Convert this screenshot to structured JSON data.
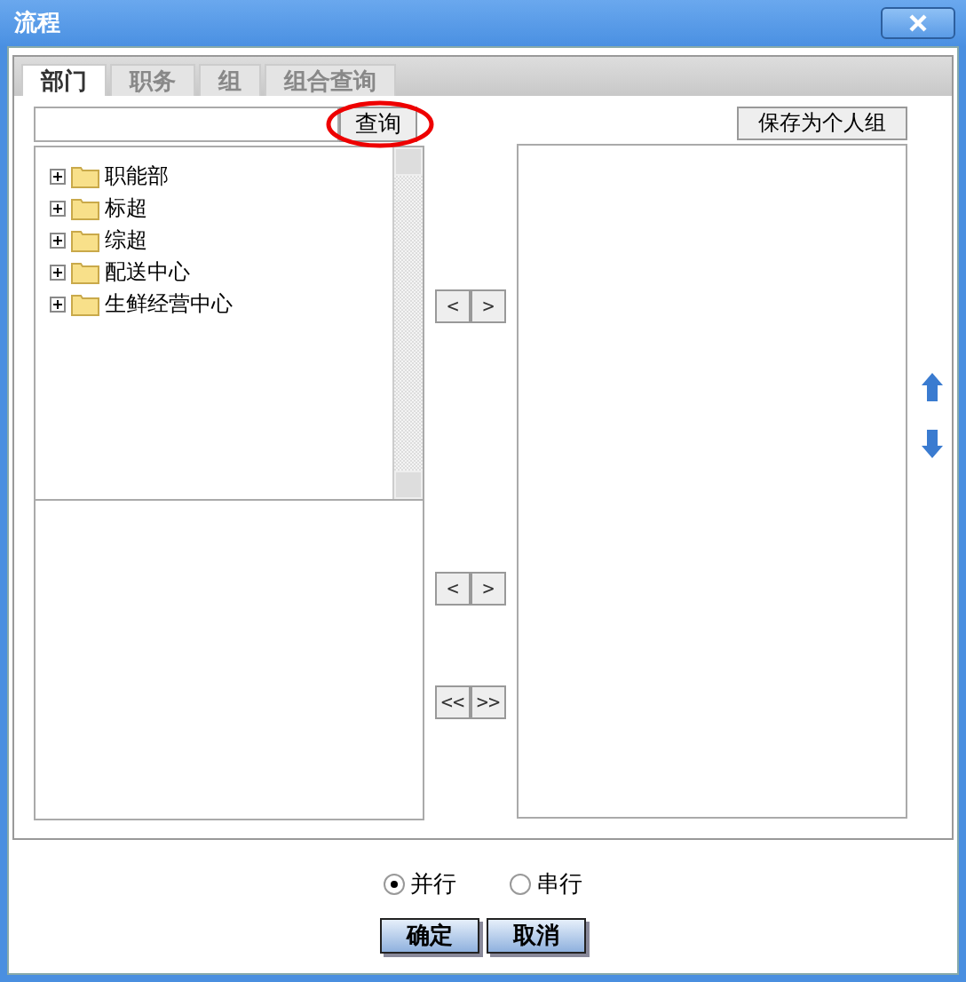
{
  "window": {
    "title": "流程"
  },
  "tabs": [
    {
      "label": "部门",
      "selected": true
    },
    {
      "label": "职务",
      "selected": false
    },
    {
      "label": "组",
      "selected": false
    },
    {
      "label": "组合查询",
      "selected": false
    }
  ],
  "search": {
    "button": "查询"
  },
  "save_button": "保存为个人组",
  "tree": [
    {
      "label": "职能部",
      "expanded": false
    },
    {
      "label": "标超",
      "expanded": false
    },
    {
      "label": "综超",
      "expanded": false
    },
    {
      "label": "配送中心",
      "expanded": false
    },
    {
      "label": "生鲜经营中心",
      "expanded": false
    }
  ],
  "transfer_buttons": [
    {
      "left": "<",
      "right": ">"
    },
    {
      "left": "<",
      "right": ">"
    },
    {
      "left": "<<",
      "right": ">>"
    }
  ],
  "mode_options": [
    {
      "label": "并行",
      "selected": true
    },
    {
      "label": "串行",
      "selected": false
    }
  ],
  "buttons": [
    "确定",
    "取消"
  ]
}
